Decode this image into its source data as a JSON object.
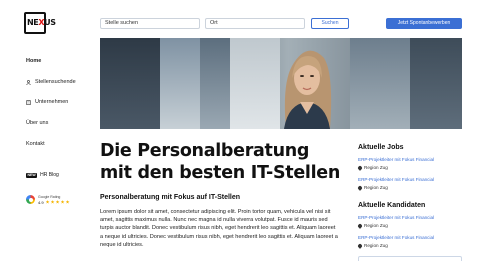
{
  "logo": {
    "text_main": "NE",
    "text_accent": "X",
    "text_end": "US"
  },
  "sidebar": {
    "items": [
      {
        "label": "Home",
        "icon": "",
        "active": true
      },
      {
        "label": "Stellensuchende",
        "icon": "person-icon",
        "active": false
      },
      {
        "label": "Unternehmen",
        "icon": "building-icon",
        "active": false
      },
      {
        "label": "Über uns",
        "icon": "",
        "active": false
      },
      {
        "label": "Kontakt",
        "icon": "",
        "active": false
      }
    ],
    "blog": {
      "badge": "NEW",
      "label": "HR Blog"
    },
    "google": {
      "label": "Google Rating",
      "score": "4.9",
      "stars": 5
    }
  },
  "topbar": {
    "search_placeholder": "Stelle suchen",
    "location_placeholder": "Ort",
    "search_button": "Suchen",
    "cta_button": "Jetzt Spontanbewerben"
  },
  "main": {
    "headline_line1": "Die Personalberatung",
    "headline_line2": "mit den besten IT-Stellen",
    "subheading": "Personalberatung mit Fokus auf IT-Stellen",
    "body": "Lorem ipsum dolor sit amet, consectetur adipiscing elit. Proin tortor quam, vehicula vel nisi sit amet, sagittis maximus nulla. Nunc nec magna id nulla viverra volutpat. Fusce id mauris sed turpis auctor blandit. Donec vestibulum risus nibh, eget hendrerit leo sagittis et. Aliquam laoreet a neque id ultricies. Donec vestibulum risus nibh, eget hendrerit leo sagittis et. Aliquam laoreet a neque id ultricies."
  },
  "jobs": {
    "title": "Aktuelle Jobs",
    "items": [
      {
        "title": "ERP-Projektleiter mit Fokus Financial",
        "region": "Region Zug"
      },
      {
        "title": "ERP-Projektleiter mit Fokus Financial",
        "region": "Region Zug"
      }
    ]
  },
  "candidates": {
    "title": "Aktuelle Kandidaten",
    "items": [
      {
        "title": "ERP-Projektleiter mit Fokus Financial",
        "region": "Region Zug"
      },
      {
        "title": "ERP-Projektleiter mit Fokus Financial",
        "region": "Region Zug"
      }
    ]
  },
  "colors": {
    "accent": "#3b6fd4",
    "logo_accent": "#dd1111"
  }
}
